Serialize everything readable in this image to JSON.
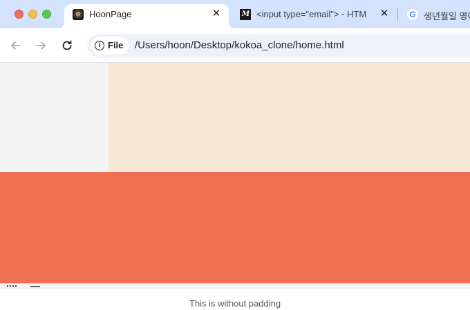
{
  "tabs": [
    {
      "title": "HoonPage",
      "favicon": "hoon-avatar-icon",
      "active": true
    },
    {
      "title": "<input type=\"email\"> - HTM",
      "favicon": "mdn-icon",
      "active": false
    },
    {
      "title": "생년월일 영어",
      "favicon": "google-icon",
      "active": false
    }
  ],
  "toolbar": {
    "site_chip_label": "File",
    "url": "/Users/hoon/Desktop/kokoa_clone/home.html"
  },
  "icons": {
    "back": "arrow-left-icon",
    "forward": "arrow-right-icon",
    "reload": "reload-icon",
    "site_info": "info-icon",
    "close": "close-icon",
    "mdn_glyph": "M",
    "google_glyph": "G",
    "info_glyph": "i",
    "close_glyph": "✕"
  },
  "page": {
    "colors": {
      "left_box": "#f4f4f4",
      "cream_box": "#f5e8d5",
      "coral_box": "#ef7053"
    }
  },
  "caption": "This is without padding"
}
